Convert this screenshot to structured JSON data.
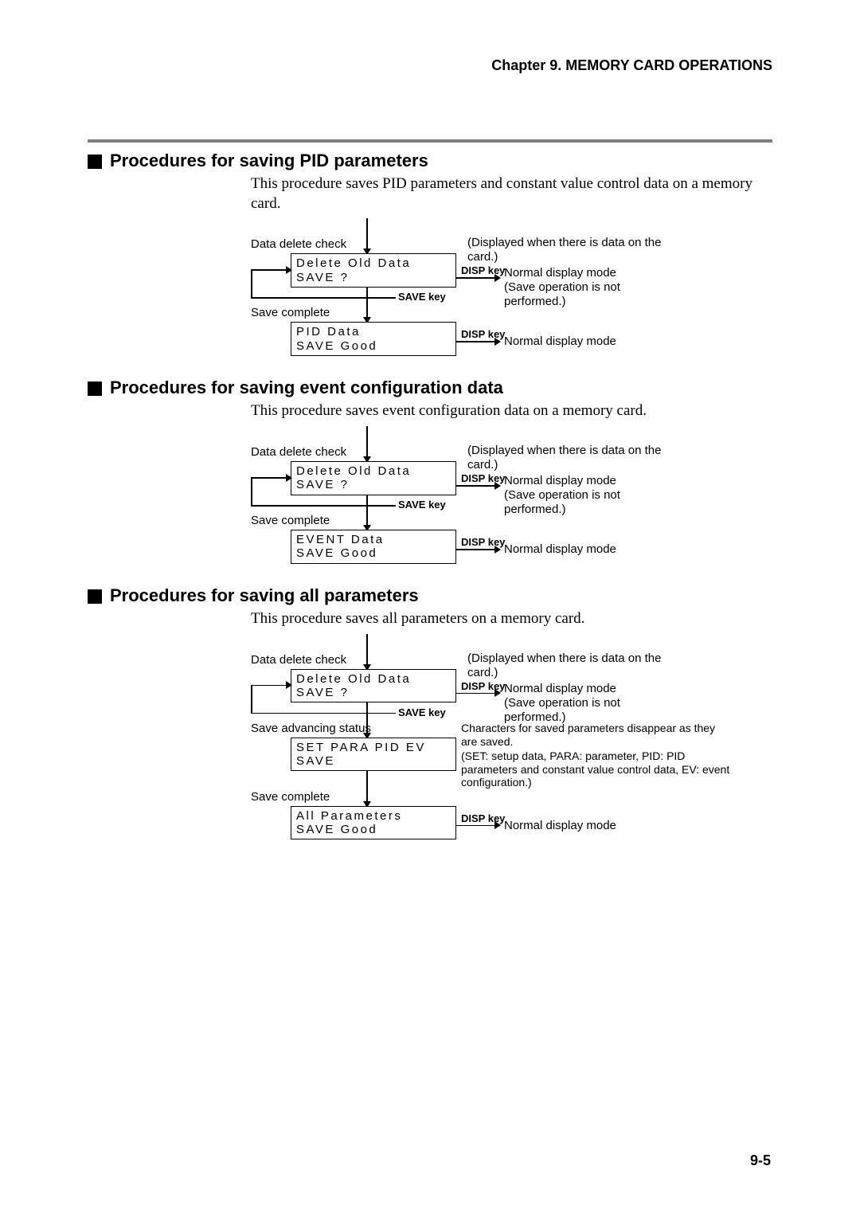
{
  "chapter_header": "Chapter 9. MEMORY CARD OPERATIONS",
  "page_number": "9-5",
  "labels": {
    "data_delete_check": "Data delete check",
    "save_complete": "Save complete",
    "save_advancing": "Save advancing status",
    "displayed_when": "(Displayed when there is data on the card.)",
    "disp_key": "DISP key",
    "save_key": "SAVE key",
    "normal_display_mode": "Normal display mode",
    "save_not_performed": "(Save operation is not performed.)",
    "all_chars_note_line1": "Characters for saved parameters disappear as they are saved.",
    "all_chars_note_line2": "(SET: setup data, PARA: parameter, PID: PID parameters and constant value control data, EV: event configuration.)"
  },
  "sections": [
    {
      "title": "Procedures for saving PID parameters",
      "intro": "This procedure saves PID parameters and constant value control data on a memory card.",
      "box1": {
        "line1": "Delete Old Data",
        "line2": "SAVE ?"
      },
      "box2": {
        "line1": "PID Data",
        "line2": "SAVE Good"
      }
    },
    {
      "title": "Procedures for saving event configuration data",
      "intro": "This procedure saves event configuration data on a memory card.",
      "box1": {
        "line1": "Delete Old Data",
        "line2": "SAVE ?"
      },
      "box2": {
        "line1": "EVENT Data",
        "line2": "SAVE Good"
      }
    },
    {
      "title": "Procedures for saving all parameters",
      "intro": "This procedure saves all parameters on a memory card.",
      "box1": {
        "line1": "Delete Old Data",
        "line2": "SAVE ?"
      },
      "box2": {
        "line1": "SET PARA PID EV",
        "line2": "SAVE"
      },
      "box3": {
        "line1": "All Parameters",
        "line2": "SAVE Good"
      }
    }
  ]
}
